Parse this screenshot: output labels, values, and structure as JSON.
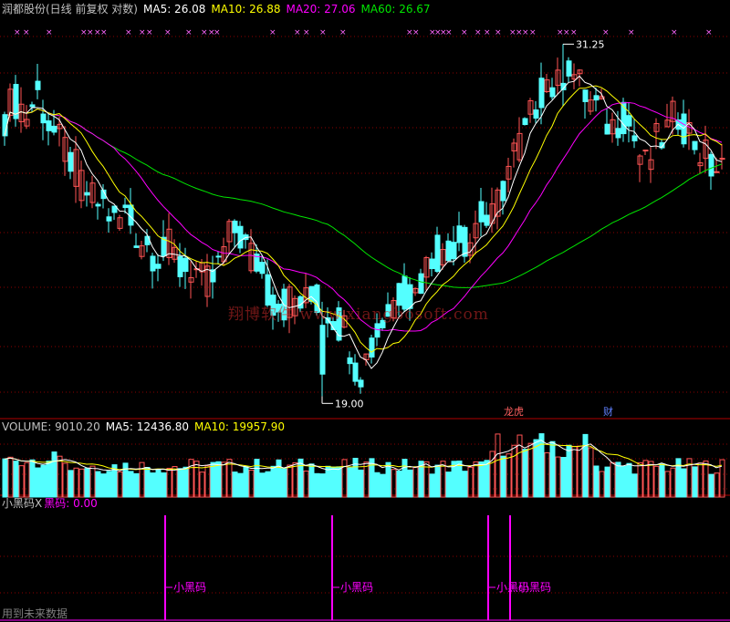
{
  "colors": {
    "background": "#000000",
    "up": "#ff5454",
    "down": "#54ffff",
    "ma5": "#ffffff",
    "ma10": "#ffff00",
    "ma20": "#ff00ff",
    "ma60": "#00e600",
    "grid": "#8b0000",
    "signal": "#ff00ff"
  },
  "header": {
    "title": "润都股份(日线 前复权 对数)",
    "ma5": "MA5: 26.08",
    "ma10": "MA10: 26.88",
    "ma20": "MA20: 27.06",
    "ma60": "MA60: 26.67"
  },
  "watermark": "翔博软件  www.xiangbosoft.com",
  "annotations": {
    "high": "31.25",
    "low": "19.00",
    "event1": "龙虎",
    "event2": "财"
  },
  "volume_header": {
    "title": "VOLUME: 9010.20",
    "ma5": "MA5: 12436.80",
    "ma10": "MA10: 19957.90"
  },
  "indicator_header": {
    "name": "小黑码X",
    "value": "黑码: 0.00"
  },
  "footnote": "用到未来数据",
  "chart_data": [
    {
      "type": "candlestick",
      "title": "润都股份(日线 前复权 对数)",
      "log_scale": true,
      "ylim": [
        18.5,
        32.0
      ],
      "series": [
        {
          "name": "MA5",
          "value": 26.08
        },
        {
          "name": "MA10",
          "value": 26.88
        },
        {
          "name": "MA20",
          "value": 27.06
        },
        {
          "name": "MA60",
          "value": 26.67
        }
      ],
      "ohlc_sampled": [
        [
          27.6,
          28.6,
          27.2,
          28.3
        ],
        [
          28.3,
          29.4,
          27.9,
          28.9
        ],
        [
          28.9,
          29.6,
          28.0,
          28.3
        ],
        [
          28.3,
          29.2,
          27.7,
          29.1
        ],
        [
          29.1,
          29.3,
          27.6,
          27.9
        ],
        [
          27.9,
          28.1,
          26.9,
          27.1
        ],
        [
          27.1,
          27.6,
          26.4,
          26.6
        ],
        [
          26.6,
          27.0,
          25.4,
          25.6
        ],
        [
          25.6,
          26.0,
          24.8,
          25.0
        ],
        [
          25.0,
          25.4,
          24.4,
          24.9
        ],
        [
          24.9,
          25.2,
          23.9,
          24.2
        ],
        [
          24.2,
          24.8,
          23.8,
          24.6
        ],
        [
          24.6,
          24.9,
          23.7,
          23.9
        ],
        [
          23.9,
          24.2,
          23.2,
          23.5
        ],
        [
          23.5,
          23.9,
          22.9,
          23.2
        ],
        [
          23.2,
          23.6,
          22.7,
          23.4
        ],
        [
          23.4,
          23.6,
          22.5,
          22.7
        ],
        [
          22.7,
          23.2,
          22.2,
          22.9
        ],
        [
          22.9,
          23.1,
          21.9,
          22.2
        ],
        [
          22.2,
          22.6,
          21.9,
          22.4
        ],
        [
          22.4,
          23.7,
          22.3,
          23.5
        ],
        [
          23.5,
          24.5,
          23.1,
          24.1
        ],
        [
          24.1,
          24.3,
          23.1,
          23.3
        ],
        [
          23.3,
          23.6,
          22.7,
          22.9
        ],
        [
          22.9,
          23.2,
          21.7,
          21.9
        ],
        [
          21.9,
          22.4,
          21.3,
          21.6
        ],
        [
          21.6,
          22.0,
          21.2,
          21.8
        ],
        [
          21.8,
          22.1,
          21.3,
          21.6
        ],
        [
          21.6,
          22.0,
          21.2,
          21.8
        ],
        [
          21.8,
          22.1,
          21.4,
          21.6
        ],
        [
          21.6,
          21.9,
          21.0,
          21.2
        ],
        [
          21.2,
          21.5,
          20.6,
          20.8
        ],
        [
          20.8,
          21.1,
          19.0,
          19.6
        ],
        [
          19.6,
          20.4,
          19.3,
          20.2
        ],
        [
          20.2,
          21.2,
          20.0,
          21.0
        ],
        [
          21.0,
          21.9,
          20.8,
          21.6
        ],
        [
          21.6,
          22.4,
          21.4,
          22.2
        ],
        [
          22.2,
          22.3,
          21.4,
          21.8
        ],
        [
          21.8,
          22.9,
          21.7,
          22.7
        ],
        [
          22.7,
          23.6,
          22.5,
          23.4
        ],
        [
          23.4,
          23.6,
          22.6,
          22.9
        ],
        [
          22.9,
          24.2,
          22.8,
          24.0
        ],
        [
          24.0,
          24.6,
          23.4,
          23.6
        ],
        [
          23.6,
          24.9,
          23.5,
          24.6
        ],
        [
          24.6,
          25.2,
          23.9,
          24.1
        ],
        [
          24.1,
          25.6,
          24.0,
          25.4
        ],
        [
          25.4,
          26.9,
          25.3,
          26.7
        ],
        [
          26.7,
          27.6,
          26.2,
          27.3
        ],
        [
          27.3,
          28.9,
          27.2,
          28.6
        ],
        [
          28.6,
          30.1,
          28.4,
          29.8
        ],
        [
          29.8,
          30.6,
          28.9,
          29.2
        ],
        [
          29.2,
          31.25,
          29.0,
          30.6
        ],
        [
          30.6,
          30.9,
          29.2,
          29.5
        ],
        [
          29.5,
          29.9,
          28.5,
          28.8
        ],
        [
          28.8,
          29.2,
          27.9,
          28.3
        ],
        [
          28.3,
          28.9,
          27.5,
          27.8
        ],
        [
          27.8,
          28.6,
          27.6,
          28.4
        ],
        [
          28.4,
          28.8,
          27.2,
          27.4
        ],
        [
          27.4,
          27.8,
          26.0,
          26.2
        ],
        [
          26.2,
          27.4,
          25.9,
          27.1
        ],
        [
          27.1,
          27.9,
          26.8,
          27.6
        ],
        [
          27.6,
          28.7,
          27.4,
          28.4
        ],
        [
          28.4,
          28.9,
          27.3,
          27.6
        ],
        [
          27.6,
          28.1,
          26.6,
          26.9
        ],
        [
          26.9,
          27.2,
          25.9,
          26.3
        ],
        [
          26.3,
          26.7,
          25.8,
          26.1
        ]
      ]
    },
    {
      "type": "bar",
      "title": "VOLUME: 9010.20",
      "series": [
        {
          "name": "VOLUME",
          "value": 9010.2
        },
        {
          "name": "MA5",
          "value": 12436.8
        },
        {
          "name": "MA10",
          "value": 19957.9
        }
      ]
    },
    {
      "type": "line",
      "title": "小黑码X",
      "series": [
        {
          "name": "黑码",
          "value": 0.0
        }
      ],
      "signal_labels": [
        "小黑码",
        "小黑码",
        "小黑码",
        "小黑码"
      ]
    }
  ]
}
